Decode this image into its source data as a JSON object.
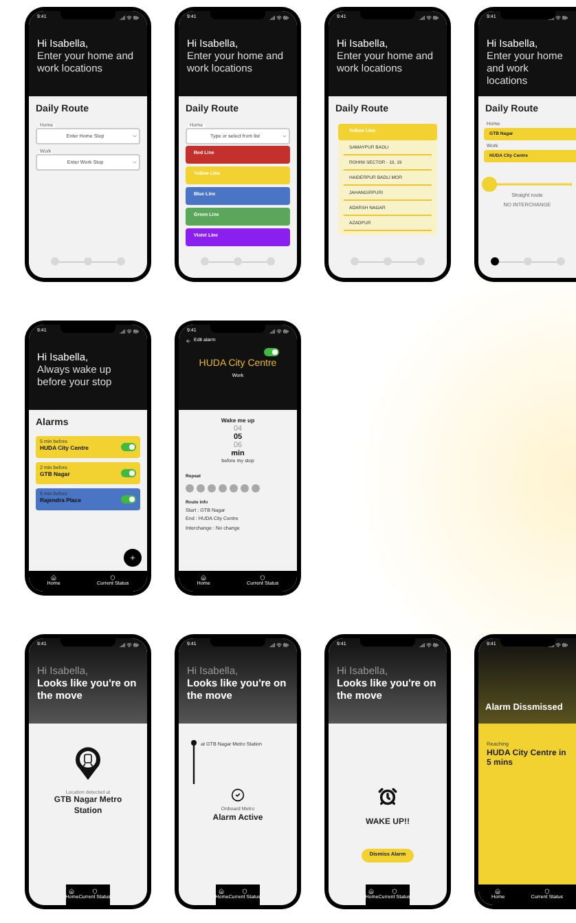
{
  "rows": [
    {
      "screens": [
        {
          "kind": "route_form",
          "time": "9:41",
          "header": {
            "greeting": "Hi Isabella,",
            "message": "Enter your home and work locations"
          },
          "title": "Daily Route",
          "fields": [
            {
              "label": "Home",
              "placeholder": "Enter Home Stop"
            },
            {
              "label": "Work",
              "placeholder": "Enter Work Stop"
            }
          ],
          "steps": [
            {
              "selected": false
            },
            {
              "selected": false
            },
            {
              "selected": false
            }
          ]
        },
        {
          "kind": "line_picker",
          "time": "9:41",
          "header": {
            "greeting": "Hi Isabella,",
            "message": "Enter your home and work locations"
          },
          "title": "Daily Route",
          "fields": [
            {
              "label": "Home",
              "placeholder": "Type or select from list"
            }
          ],
          "lines": [
            {
              "name": "Red Line",
              "color": "#c4302b"
            },
            {
              "name": "Yellow Line",
              "color": "#f2d230"
            },
            {
              "name": "Blue Line",
              "color": "#4a74c4"
            },
            {
              "name": "Green Line",
              "color": "#5aa65a"
            },
            {
              "name": "Violet Line",
              "color": "#8a1ff0"
            }
          ],
          "steps": [
            {
              "selected": false
            },
            {
              "selected": false
            },
            {
              "selected": false
            }
          ]
        },
        {
          "kind": "station_list",
          "time": "9:41",
          "header": {
            "greeting": "Hi Isabella,",
            "message": "Enter your home and work locations"
          },
          "title": "Daily Route",
          "line": {
            "name": "Yellow Line",
            "color": "#f2d230"
          },
          "stations": [
            "SAMAYPUR BADLI",
            "ROHINI SECTOR - 18, 19",
            "HAIDERPUR BADLI MOR",
            "JAHANGIRPURI",
            "ADARSH NAGAR",
            "AZADPUR"
          ],
          "steps": [
            {
              "selected": false
            },
            {
              "selected": false
            },
            {
              "selected": false
            }
          ]
        },
        {
          "kind": "route_summary",
          "time": "9:41",
          "header": {
            "greeting": "Hi Isabella,",
            "message": "Enter your home and work locations"
          },
          "title": "Daily Route",
          "fields": [
            {
              "label": "Home",
              "value": "GTB Nagar"
            },
            {
              "label": "Work",
              "value": "HUDA City Centre"
            }
          ],
          "route": "Straight route",
          "interchange": "NO INTERCHANGE",
          "steps": [
            {
              "selected": true
            },
            {
              "selected": false
            },
            {
              "selected": false
            }
          ]
        }
      ]
    },
    {
      "screens": [
        {
          "kind": "alarms",
          "time": "9:41",
          "header": {
            "greeting": "Hi Isabella,",
            "message": "Always wake up before your stop"
          },
          "title": "Alarms",
          "alarms": [
            {
              "offset": "5 min before",
              "station": "HUDA City Centre",
              "on": true,
              "color": "#f2d230"
            },
            {
              "offset": "2 min before",
              "station": "GTB Nagar",
              "on": true,
              "color": "#f2d230"
            },
            {
              "offset": "5 min before",
              "station": "Rajendra Place",
              "on": true,
              "color": "#4a74c4"
            }
          ],
          "nav": [
            "Home",
            "Current Status"
          ]
        },
        {
          "kind": "edit_alarm",
          "time": "9:41",
          "back": "Edit alarm",
          "on": true,
          "station": "HUDA City Centre",
          "label": "Work",
          "wake_title": "Wake me up",
          "minutes": [
            {
              "value": "04",
              "selected": false
            },
            {
              "value": "05",
              "selected": true
            },
            {
              "value": "06",
              "selected": false
            }
          ],
          "unit": "min",
          "caption": "before my stop",
          "repeat_title": "Repeat",
          "days": [
            {
              "selected": false
            },
            {
              "selected": false
            },
            {
              "selected": false
            },
            {
              "selected": false
            },
            {
              "selected": false
            },
            {
              "selected": false
            },
            {
              "selected": false
            }
          ],
          "info_title": "Route info",
          "info": [
            "Start : GTB Nagar",
            "End : HUDA City Centre",
            "Interchange : No change"
          ],
          "nav": [
            "Home",
            "Current Status"
          ]
        }
      ]
    },
    {
      "screens": [
        {
          "kind": "location_detected",
          "time": "9:41",
          "header": {
            "greeting": "Hi Isabella,",
            "message": "Looks like you're on the move"
          },
          "caption": "Location detected at",
          "station": "GTB Nagar Metro Station",
          "nav": [
            "Home",
            "Current Status"
          ]
        },
        {
          "kind": "onboard",
          "time": "9:41",
          "header": {
            "greeting": "Hi Isabella,",
            "message": "Looks like you're on the move"
          },
          "position": "at GTB Nagar Metro Station",
          "caption": "Onboard Metro",
          "status": "Alarm Active",
          "nav": [
            "Home",
            "Current Status"
          ]
        },
        {
          "kind": "wake_up",
          "time": "9:41",
          "header": {
            "greeting": "Hi Isabella,",
            "message": "Looks like you're on the move"
          },
          "alert": "WAKE UP!!",
          "button": "Dismiss Alarm",
          "nav": [
            "Home",
            "Current Status"
          ]
        },
        {
          "kind": "dismissed",
          "time": "9:41",
          "title": "Alarm Dissmissed",
          "caption": "Reaching",
          "destination": "HUDA City Centre in 5 mins",
          "nav": [
            "Home",
            "Current Status"
          ]
        }
      ]
    }
  ]
}
